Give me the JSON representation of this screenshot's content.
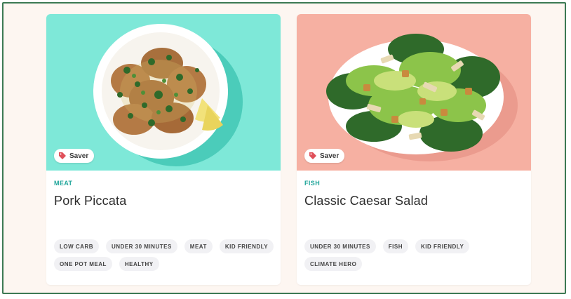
{
  "colors": {
    "frame_border": "#3c7a54",
    "category_accent": "#1fa59a",
    "card1_bg": "#7ee8d8",
    "card2_bg": "#f6b0a2"
  },
  "recipes": [
    {
      "badge": "Saver",
      "badge_icon": "price-tag-icon",
      "category": "MEAT",
      "title": "Pork Piccata",
      "tags": [
        "LOW CARB",
        "UNDER 30 MINUTES",
        "MEAT",
        "KID FRIENDLY",
        "ONE POT MEAL",
        "HEALTHY"
      ]
    },
    {
      "badge": "Saver",
      "badge_icon": "price-tag-icon",
      "category": "FISH",
      "title": "Classic Caesar Salad",
      "tags": [
        "UNDER 30 MINUTES",
        "FISH",
        "KID FRIENDLY",
        "CLIMATE HERO"
      ]
    }
  ]
}
